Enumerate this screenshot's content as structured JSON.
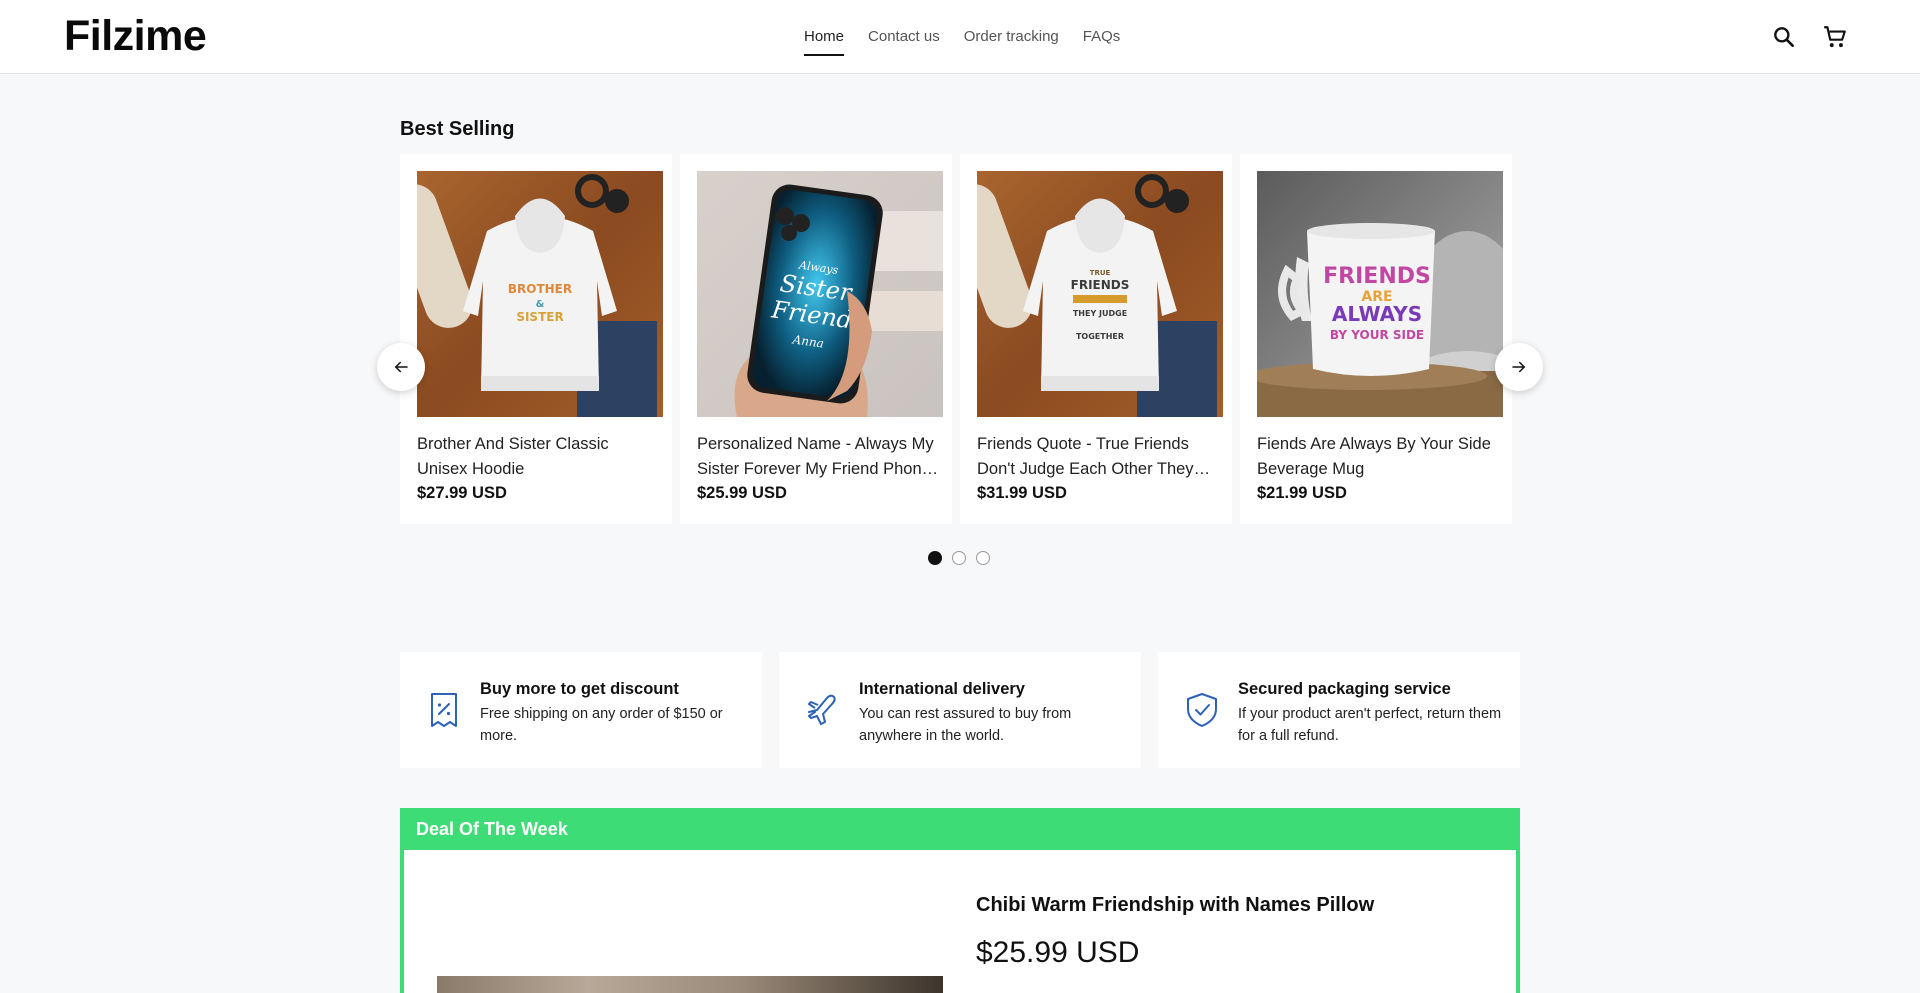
{
  "header": {
    "logo": "Filzime",
    "nav": [
      {
        "label": "Home",
        "active": true
      },
      {
        "label": "Contact us",
        "active": false
      },
      {
        "label": "Order tracking",
        "active": false
      },
      {
        "label": "FAQs",
        "active": false
      }
    ],
    "icons": [
      "search-icon",
      "cart-icon"
    ]
  },
  "best_selling": {
    "title": "Best Selling",
    "products": [
      {
        "name": "Brother And Sister Classic Unisex Hoodie",
        "price": "$27.99 USD",
        "image": "hoodie",
        "print": [
          "BROTHER",
          "&",
          "SISTER"
        ]
      },
      {
        "name": "Personalized Name - Always My Sister Forever My Friend Phone Case",
        "price": "$25.99 USD",
        "image": "phone-case",
        "print": [
          "Always",
          "Sister",
          "Friend",
          "Anna"
        ]
      },
      {
        "name": "Friends Quote - True Friends Don't Judge Each Other They Judge Other People Together",
        "price": "$31.99 USD",
        "image": "hoodie",
        "print": [
          "TRUE",
          "FRIENDS",
          "THEY JUDGE",
          "TOGETHER"
        ]
      },
      {
        "name": "Fiends Are Always By Your Side Beverage Mug",
        "price": "$21.99 USD",
        "image": "mug",
        "print": [
          "FRIENDS",
          "ARE",
          "ALWAYS",
          "BY YOUR SIDE"
        ]
      }
    ],
    "arrows": {
      "prev": "arrow-left-icon",
      "next": "arrow-right-icon"
    },
    "pagination": {
      "pages": 3,
      "current": 1
    }
  },
  "features": [
    {
      "icon": "discount-tag-icon",
      "title": "Buy more to get discount",
      "desc": "Free shipping on any order of $150 or more."
    },
    {
      "icon": "airplane-icon",
      "title": "International delivery",
      "desc": "You can rest assured to buy from anywhere in the world."
    },
    {
      "icon": "shield-check-icon",
      "title": "Secured packaging service",
      "desc": "If your product aren't perfect, return them for a full refund."
    }
  ],
  "deal": {
    "heading": "Deal Of The Week",
    "product_name": "Chibi Warm Friendship with Names Pillow",
    "price": "$25.99 USD"
  },
  "colors": {
    "accent": "#3ddc76",
    "icon_blue": "#2e62b8",
    "text": "#111111"
  }
}
